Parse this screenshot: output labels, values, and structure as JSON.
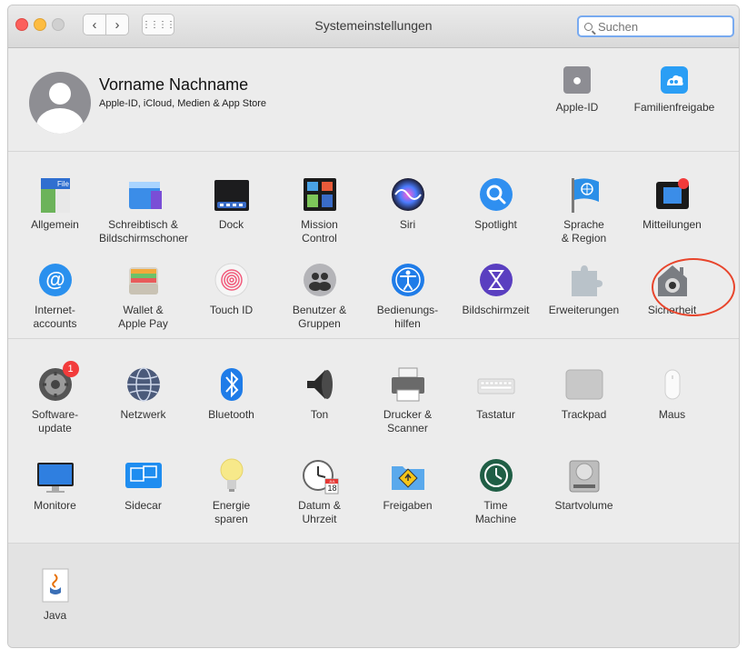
{
  "window": {
    "title": "Systemeinstellungen"
  },
  "search": {
    "placeholder": "Suchen"
  },
  "account": {
    "name": "Vorname Nachname",
    "subtitle": "Apple-ID, iCloud, Medien & App Store",
    "items": [
      {
        "label": "Apple-ID",
        "icon": "apple-logo-icon"
      },
      {
        "label": "Familienfreigabe",
        "icon": "family-sharing-icon"
      }
    ]
  },
  "section1": {
    "row1": [
      {
        "label": "Allgemein",
        "icon": "general-icon"
      },
      {
        "label": "Schreibtisch &\nBildschirmschoner",
        "icon": "desktop-screensaver-icon"
      },
      {
        "label": "Dock",
        "icon": "dock-icon"
      },
      {
        "label": "Mission\nControl",
        "icon": "mission-control-icon"
      },
      {
        "label": "Siri",
        "icon": "siri-icon"
      },
      {
        "label": "Spotlight",
        "icon": "spotlight-icon"
      },
      {
        "label": "Sprache\n& Region",
        "icon": "language-region-icon"
      },
      {
        "label": "Mitteilungen",
        "icon": "notifications-icon"
      }
    ],
    "row2": [
      {
        "label": "Internet-\naccounts",
        "icon": "internet-accounts-icon"
      },
      {
        "label": "Wallet &\nApple Pay",
        "icon": "wallet-icon"
      },
      {
        "label": "Touch ID",
        "icon": "touch-id-icon"
      },
      {
        "label": "Benutzer &\nGruppen",
        "icon": "users-groups-icon"
      },
      {
        "label": "Bedienungs-\nhilfen",
        "icon": "accessibility-icon"
      },
      {
        "label": "Bildschirmzeit",
        "icon": "screen-time-icon"
      },
      {
        "label": "Erweiterungen",
        "icon": "extensions-icon"
      },
      {
        "label": "Sicherheit",
        "icon": "security-icon"
      }
    ]
  },
  "section2": {
    "row1": [
      {
        "label": "Software-\nupdate",
        "icon": "software-update-icon",
        "badge": "1"
      },
      {
        "label": "Netzwerk",
        "icon": "network-icon"
      },
      {
        "label": "Bluetooth",
        "icon": "bluetooth-icon"
      },
      {
        "label": "Ton",
        "icon": "sound-icon"
      },
      {
        "label": "Drucker &\nScanner",
        "icon": "printer-icon"
      },
      {
        "label": "Tastatur",
        "icon": "keyboard-icon"
      },
      {
        "label": "Trackpad",
        "icon": "trackpad-icon"
      },
      {
        "label": "Maus",
        "icon": "mouse-icon"
      }
    ],
    "row2": [
      {
        "label": "Monitore",
        "icon": "displays-icon"
      },
      {
        "label": "Sidecar",
        "icon": "sidecar-icon"
      },
      {
        "label": "Energie\nsparen",
        "icon": "energy-saver-icon"
      },
      {
        "label": "Datum &\nUhrzeit",
        "icon": "date-time-icon",
        "calendar_month": "JUL",
        "calendar_day": "18"
      },
      {
        "label": "Freigaben",
        "icon": "sharing-icon"
      },
      {
        "label": "Time\nMachine",
        "icon": "time-machine-icon"
      },
      {
        "label": "Startvolume",
        "icon": "startup-disk-icon"
      }
    ]
  },
  "section3": {
    "row1": [
      {
        "label": "Java",
        "icon": "java-icon"
      }
    ]
  },
  "colors": {
    "highlight": "#e8452c",
    "search_focus": "#78aaf0",
    "badge": "#f23b3b"
  }
}
